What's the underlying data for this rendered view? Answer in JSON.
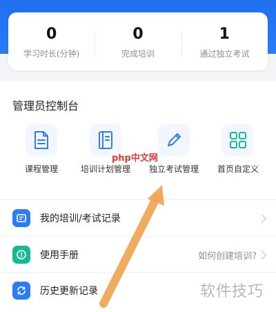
{
  "stats": [
    {
      "value": "0",
      "label": "学习时长(分钟)"
    },
    {
      "value": "0",
      "label": "完成培训"
    },
    {
      "value": "1",
      "label": "通过独立考试"
    }
  ],
  "admin": {
    "title": "管理员控制台",
    "tools": [
      {
        "label": "课程管理",
        "icon": "document-icon"
      },
      {
        "label": "培训计划管理",
        "icon": "book-icon"
      },
      {
        "label": "独立考试管理",
        "icon": "pencil-icon"
      },
      {
        "label": "首页自定义",
        "icon": "grid-icon"
      }
    ]
  },
  "list": [
    {
      "label": "我的培训/考试记录",
      "right": ""
    },
    {
      "label": "使用手册",
      "right": "如何创建培训?"
    },
    {
      "label": "历史更新记录",
      "right": ""
    }
  ],
  "watermarks": {
    "php": "php中文网",
    "brand": "软件技巧"
  },
  "colors": {
    "blue": "#2b7cf6",
    "teal": "#16b895",
    "arrow": "#f2a356"
  }
}
